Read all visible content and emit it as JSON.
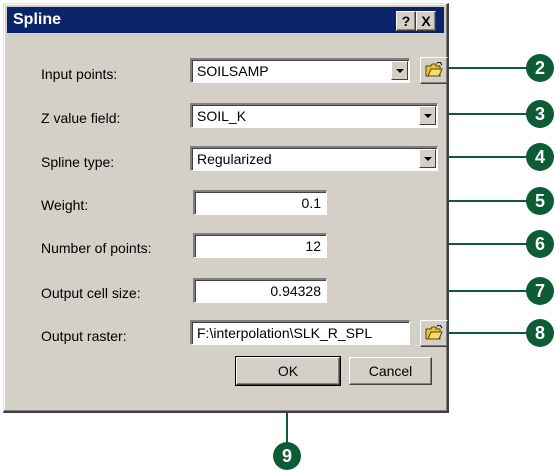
{
  "dialog": {
    "title": "Spline",
    "help_button": "?",
    "close_button": "X"
  },
  "fields": {
    "input_points": {
      "label": "Input points:",
      "value": "SOILSAMP"
    },
    "z_value_field": {
      "label": "Z value field:",
      "value": "SOIL_K"
    },
    "spline_type": {
      "label": "Spline type:",
      "value": "Regularized"
    },
    "weight": {
      "label": "Weight:",
      "value": "0.1"
    },
    "number_of_points": {
      "label": "Number of points:",
      "value": "12"
    },
    "output_cell_size": {
      "label": "Output cell size:",
      "value": "0.94328"
    },
    "output_raster": {
      "label": "Output raster:",
      "value": "F:\\interpolation\\SLK_R_SPL"
    }
  },
  "buttons": {
    "ok": "OK",
    "cancel": "Cancel"
  },
  "callouts": [
    "2",
    "3",
    "4",
    "5",
    "6",
    "7",
    "8",
    "9"
  ],
  "icons": {
    "browse": "open-folder-icon"
  },
  "colors": {
    "titlebar": "#0a246a",
    "dialog_face": "#d4d0c8",
    "callout": "#0d5c36"
  }
}
